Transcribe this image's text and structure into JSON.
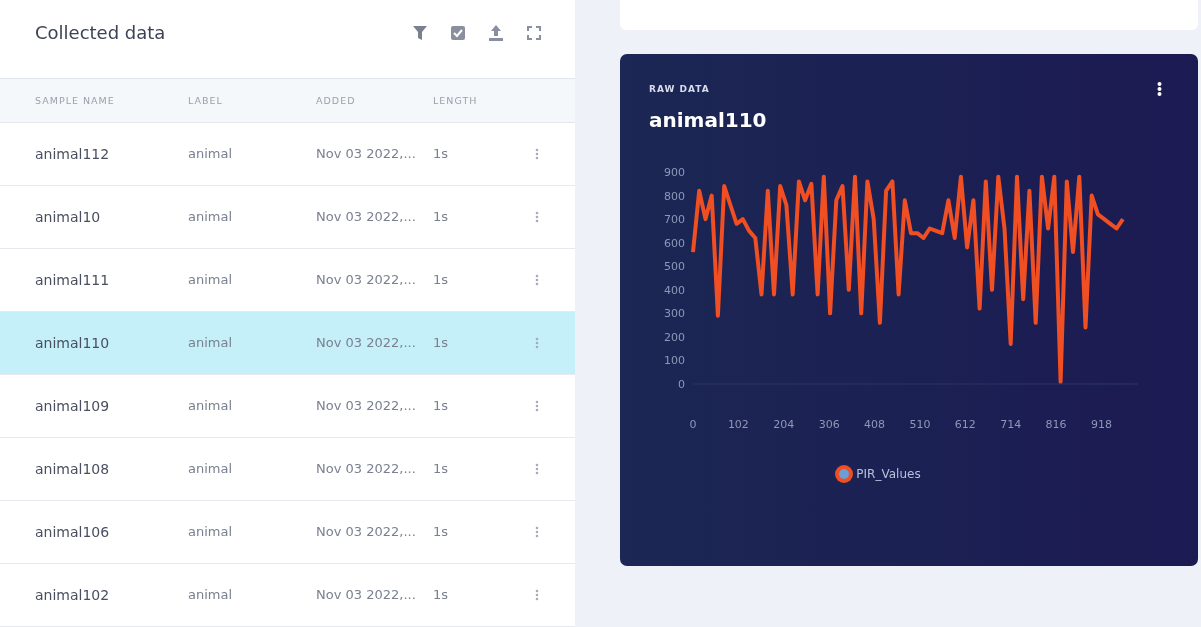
{
  "panel": {
    "title": "Collected data"
  },
  "table": {
    "columns": [
      "SAMPLE NAME",
      "LABEL",
      "ADDED",
      "LENGTH"
    ],
    "rows": [
      {
        "name": "animal112",
        "label": "animal",
        "added": "Nov 03 2022,...",
        "length": "1s",
        "selected": false
      },
      {
        "name": "animal10",
        "label": "animal",
        "added": "Nov 03 2022,...",
        "length": "1s",
        "selected": false
      },
      {
        "name": "animal111",
        "label": "animal",
        "added": "Nov 03 2022,...",
        "length": "1s",
        "selected": false
      },
      {
        "name": "animal110",
        "label": "animal",
        "added": "Nov 03 2022,...",
        "length": "1s",
        "selected": true
      },
      {
        "name": "animal109",
        "label": "animal",
        "added": "Nov 03 2022,...",
        "length": "1s",
        "selected": false
      },
      {
        "name": "animal108",
        "label": "animal",
        "added": "Nov 03 2022,...",
        "length": "1s",
        "selected": false
      },
      {
        "name": "animal106",
        "label": "animal",
        "added": "Nov 03 2022,...",
        "length": "1s",
        "selected": false
      },
      {
        "name": "animal102",
        "label": "animal",
        "added": "Nov 03 2022,...",
        "length": "1s",
        "selected": false
      }
    ]
  },
  "raw_data": {
    "caption": "RAW DATA",
    "title": "animal110",
    "chart_data": {
      "type": "line",
      "xlim": [
        0,
        1000
      ],
      "ylim": [
        0,
        900
      ],
      "xticks": [
        0,
        102,
        204,
        306,
        408,
        510,
        612,
        714,
        816,
        918
      ],
      "yticks": [
        0,
        100,
        200,
        300,
        400,
        500,
        600,
        700,
        800,
        900
      ],
      "x": [
        0,
        14,
        28,
        42,
        56,
        70,
        84,
        98,
        112,
        126,
        140,
        154,
        168,
        182,
        196,
        210,
        224,
        238,
        252,
        266,
        280,
        294,
        308,
        322,
        336,
        350,
        364,
        378,
        392,
        406,
        420,
        434,
        448,
        462,
        476,
        490,
        504,
        518,
        532,
        546,
        560,
        574,
        588,
        602,
        616,
        630,
        644,
        658,
        672,
        686,
        700,
        714,
        728,
        742,
        756,
        770,
        784,
        798,
        812,
        826,
        840,
        854,
        868,
        882,
        896,
        910,
        924,
        938,
        952,
        966
      ],
      "series": [
        {
          "name": "PIR_Values",
          "color": "#f04e23",
          "values": [
            560,
            820,
            700,
            800,
            290,
            840,
            760,
            680,
            700,
            650,
            620,
            380,
            820,
            380,
            840,
            760,
            380,
            860,
            780,
            850,
            380,
            880,
            300,
            780,
            840,
            400,
            880,
            300,
            860,
            700,
            260,
            820,
            860,
            380,
            780,
            640,
            640,
            620,
            660,
            650,
            640,
            780,
            620,
            880,
            580,
            780,
            320,
            860,
            400,
            880,
            660,
            170,
            880,
            360,
            820,
            260,
            880,
            660,
            880,
            10,
            860,
            560,
            880,
            240,
            800,
            720,
            700,
            680,
            660,
            700
          ]
        }
      ]
    }
  }
}
